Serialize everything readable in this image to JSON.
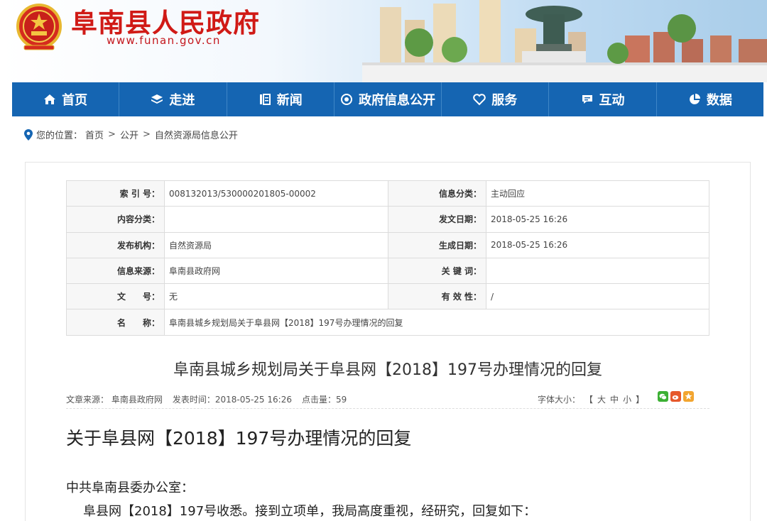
{
  "header": {
    "site_title": "阜南县人民政府",
    "site_url": "www.funan.gov.cn",
    "emblem_icon": "national-emblem-icon"
  },
  "nav": {
    "items": [
      {
        "label": "首页",
        "icon": "home-icon"
      },
      {
        "label": "走进",
        "icon": "layers-icon"
      },
      {
        "label": "新闻",
        "icon": "news-icon"
      },
      {
        "label": "政府信息公开",
        "icon": "info-icon"
      },
      {
        "label": "服务",
        "icon": "service-icon"
      },
      {
        "label": "互动",
        "icon": "chat-icon"
      },
      {
        "label": "数据",
        "icon": "pie-chart-icon"
      }
    ],
    "color": "#1565b2"
  },
  "breadcrumb": {
    "prefix": "您的位置：",
    "items": [
      "首页",
      "公开",
      "自然资源局信息公开"
    ],
    "sep": ">"
  },
  "info": {
    "rows": [
      {
        "l1": "索 引 号：",
        "v1": "008132013/530000201805-00002",
        "l2": "信息分类：",
        "v2": "主动回应"
      },
      {
        "l1": "内容分类：",
        "v1": "",
        "l2": "发文日期：",
        "v2": "2018-05-25 16:26"
      },
      {
        "l1": "发布机构：",
        "v1": "自然资源局",
        "l2": "生成日期：",
        "v2": "2018-05-25 16:26"
      },
      {
        "l1": "信息来源：",
        "v1": "阜南县政府网",
        "l2": "关 键 词：",
        "v2": ""
      },
      {
        "l1": "文　　号：",
        "v1": "无",
        "l2": "有 效 性：",
        "v2": "/"
      }
    ],
    "name_label": "名　　称：",
    "name_value": "阜南县城乡规划局关于阜县网【2018】197号办理情况的回复"
  },
  "article": {
    "title": "阜南县城乡规划局关于阜县网【2018】197号办理情况的回复",
    "source": "文章来源： 阜南县政府网",
    "time": "发表时间：2018-05-25 16:26",
    "hits": "点击量：59",
    "font_size_label": "字体大小：",
    "font_bracket_open": "【",
    "font_large": "大",
    "font_medium": "中",
    "font_small": "小",
    "font_bracket_close": "】",
    "body_heading": "关于阜县网【2018】197号办理情况的回复",
    "p1": "中共阜南县委办公室：",
    "p2": "阜县网【2018】197号收悉。接到立项单，我局高度重视，经研究，回复如下："
  },
  "share": [
    {
      "icon": "wechat-icon",
      "color": "#3cb034"
    },
    {
      "icon": "weibo-icon",
      "color": "#e6582b"
    },
    {
      "icon": "star-icon",
      "color": "#f2a530"
    }
  ]
}
